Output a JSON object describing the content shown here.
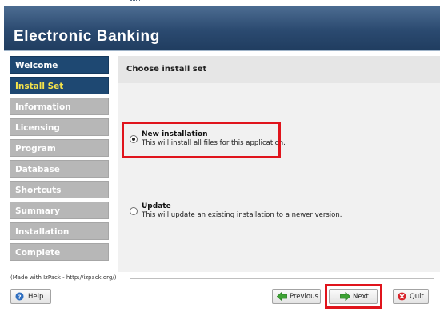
{
  "window": {
    "title": "Electronic Banking"
  },
  "sidebar": {
    "items": [
      {
        "label": "Welcome",
        "state": "visited"
      },
      {
        "label": "Install Set",
        "state": "current"
      },
      {
        "label": "Information",
        "state": "pending"
      },
      {
        "label": "Licensing",
        "state": "pending"
      },
      {
        "label": "Program",
        "state": "pending"
      },
      {
        "label": "Database",
        "state": "pending"
      },
      {
        "label": "Shortcuts",
        "state": "pending"
      },
      {
        "label": "Summary",
        "state": "pending"
      },
      {
        "label": "Installation",
        "state": "pending"
      },
      {
        "label": "Complete",
        "state": "pending"
      }
    ]
  },
  "main": {
    "heading": "Choose install set",
    "options": [
      {
        "title": "New installation",
        "description": "This will install all files for this application.",
        "selected": true
      },
      {
        "title": "Update",
        "description": "This will update an existing installation to a newer version.",
        "selected": false
      }
    ]
  },
  "footer": {
    "credit": "(Made with IzPack - http://izpack.org/)",
    "help_label": "Help",
    "previous_label": "Previous",
    "next_label": "Next",
    "quit_label": "Quit"
  },
  "colors": {
    "banner": "#2b4a70",
    "sidebar_active": "#1e4872",
    "sidebar_current_text": "#f4e24a",
    "sidebar_pending": "#b7b7b7",
    "highlight": "#e0141c"
  },
  "icons": {
    "help": "question-circle-icon",
    "previous": "green-arrow-left-icon",
    "next": "green-arrow-right-icon",
    "quit": "red-x-circle-icon"
  }
}
